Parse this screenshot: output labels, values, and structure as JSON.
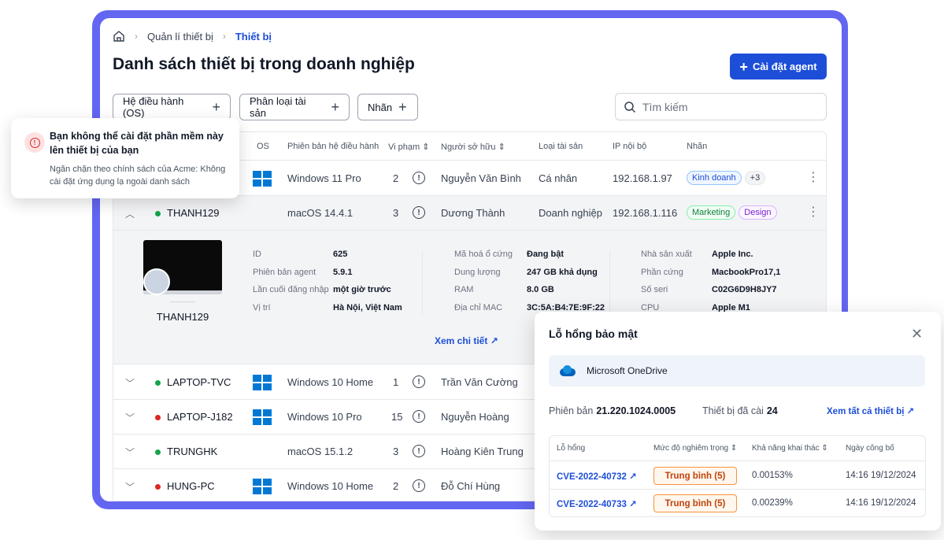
{
  "breadcrumb": {
    "items": [
      "Quản lí thiết bị",
      "Thiết bị"
    ]
  },
  "page": {
    "title": "Danh sách thiết bị trong doanh nghiệp",
    "install_label": "Cài đặt agent"
  },
  "filters": [
    "Hệ điều hành (OS)",
    "Phân loại tài sản",
    "Nhãn"
  ],
  "search": {
    "placeholder": "Tìm kiếm"
  },
  "table": {
    "headers": {
      "os": "OS",
      "os_version": "Phiên bản hệ điều hành",
      "violations": "Vi phạm",
      "owner": "Người sở hữu",
      "asset_type": "Loại tài sản",
      "ip": "IP nội bộ",
      "tags": "Nhãn"
    },
    "rows": [
      {
        "name": "",
        "os": "windows",
        "os_version": "Windows 11 Pro",
        "violations": "2",
        "owner": "Nguyễn Văn Bình",
        "asset_type": "Cá nhân",
        "ip": "192.168.1.97",
        "tags": [
          "Kinh doanh",
          "+3"
        ]
      },
      {
        "name": "THANH129",
        "status": "online",
        "os": "mac",
        "os_version": "macOS 14.4.1",
        "violations": "3",
        "owner": "Dương Thành",
        "asset_type": "Doanh nghiệp",
        "ip": "192.168.1.116",
        "tags": [
          "Marketing",
          "Design"
        ]
      },
      {
        "name": "LAPTOP-TVC",
        "status": "online",
        "os": "windows",
        "os_version": "Windows 10 Home",
        "violations": "1",
        "owner": "Trần Văn Cường"
      },
      {
        "name": "LAPTOP-J182",
        "status": "offline",
        "os": "windows",
        "os_version": "Windows 10 Pro",
        "violations": "15",
        "owner": "Nguyễn Hoàng"
      },
      {
        "name": "TRUNGHK",
        "status": "online",
        "os": "mac",
        "os_version": "macOS 15.1.2",
        "violations": "3",
        "owner": "Hoàng Kiên Trung"
      },
      {
        "name": "HUNG-PC",
        "status": "offline",
        "os": "windows",
        "os_version": "Windows 10 Home",
        "violations": "2",
        "owner": "Đỗ Chí Hùng"
      }
    ]
  },
  "detail": {
    "device_name": "THANH129",
    "col1": [
      [
        "ID",
        "625"
      ],
      [
        "Phiên bản agent",
        "5.9.1"
      ],
      [
        "Lần cuối đăng nhập",
        "một giờ trước"
      ],
      [
        "Vị trí",
        "Hà Nội, Việt Nam"
      ]
    ],
    "col2": [
      [
        "Mã hoá ổ cứng",
        "Đang bật"
      ],
      [
        "Dung lượng",
        "247 GB khả dụng"
      ],
      [
        "RAM",
        "8.0 GB"
      ],
      [
        "Địa chỉ MAC",
        "3C:5A:B4:7E:9F:22"
      ]
    ],
    "col3": [
      [
        "Nhà sản xuất",
        "Apple Inc."
      ],
      [
        "Phần cứng",
        "MacbookPro17,1"
      ],
      [
        "Số seri",
        "C02G6D9H8JY7"
      ],
      [
        "CPU",
        "Apple M1"
      ]
    ],
    "see_detail": "Xem chi tiết"
  },
  "toast": {
    "title": "Bạn không thể cài đặt phần mềm này lên thiết bị của bạn",
    "body": "Ngăn chặn theo chính sách của Acme: Không cài đặt ứng dụng lạ ngoài danh sách"
  },
  "vuln": {
    "title": "Lỗ hổng bảo mật",
    "app": "Microsoft OneDrive",
    "version_label": "Phiên bản",
    "version": "21.220.1024.0005",
    "installed_label": "Thiết bị đã cài",
    "installed": "24",
    "see_all": "Xem tất cả thiết bị",
    "headers": {
      "cve": "Lỗ hổng",
      "severity": "Mức độ nghiêm trọng",
      "exploit": "Khả năng khai thác",
      "date": "Ngày công bố"
    },
    "rows": [
      {
        "cve": "CVE-2022-40732",
        "severity": "Trung bình (5)",
        "exploit": "0.00153%",
        "date": "14:16 19/12/2024"
      },
      {
        "cve": "CVE-2022-40733",
        "severity": "Trung bình (5)",
        "exploit": "0.00239%",
        "date": "14:16 19/12/2024"
      }
    ]
  },
  "colors": {
    "accent": "#1d4ed8",
    "frame": "#6366f1",
    "online": "#16a34a",
    "offline": "#dc2626",
    "severity": "#c2410c"
  }
}
